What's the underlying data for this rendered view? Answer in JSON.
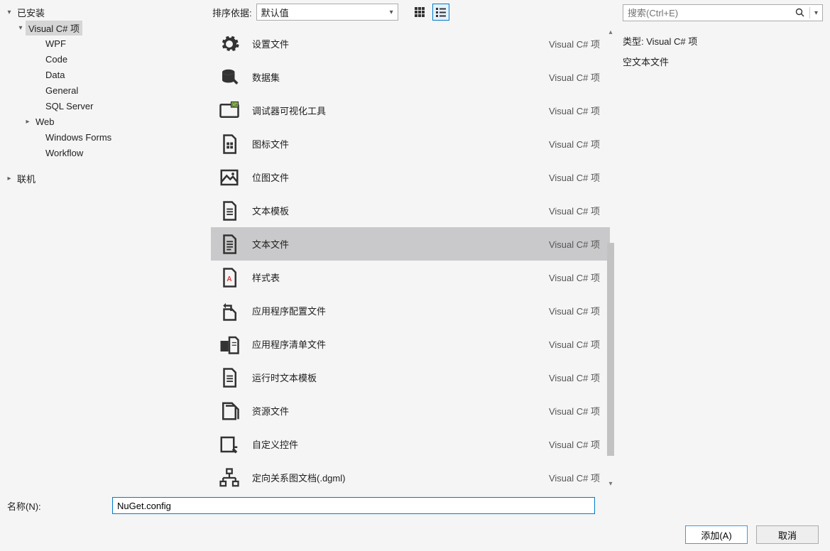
{
  "tree": {
    "installed": "已安装",
    "visual_csharp": "Visual C# 项",
    "children": [
      "WPF",
      "Code",
      "Data",
      "General",
      "SQL Server",
      "Web",
      "Windows Forms",
      "Workflow"
    ],
    "online": "联机"
  },
  "toolbar": {
    "sort_label": "排序依据:",
    "sort_value": "默认值"
  },
  "templates": [
    {
      "name": "设置文件",
      "cat": "Visual C# 项"
    },
    {
      "name": "数据集",
      "cat": "Visual C# 项"
    },
    {
      "name": "调试器可视化工具",
      "cat": "Visual C# 项"
    },
    {
      "name": "图标文件",
      "cat": "Visual C# 项"
    },
    {
      "name": "位图文件",
      "cat": "Visual C# 项"
    },
    {
      "name": "文本模板",
      "cat": "Visual C# 项"
    },
    {
      "name": "文本文件",
      "cat": "Visual C# 项",
      "selected": true
    },
    {
      "name": "样式表",
      "cat": "Visual C# 项"
    },
    {
      "name": "应用程序配置文件",
      "cat": "Visual C# 项"
    },
    {
      "name": "应用程序清单文件",
      "cat": "Visual C# 项"
    },
    {
      "name": "运行时文本模板",
      "cat": "Visual C# 项"
    },
    {
      "name": "资源文件",
      "cat": "Visual C# 项"
    },
    {
      "name": "自定义控件",
      "cat": "Visual C# 项"
    },
    {
      "name": "定向关系图文档(.dgml)",
      "cat": "Visual C# 项"
    }
  ],
  "search": {
    "placeholder": "搜索(Ctrl+E)"
  },
  "info": {
    "type_label": "类型:",
    "type_value": "Visual C# 项",
    "desc": "空文本文件"
  },
  "bottom": {
    "name_label": "名称(N):",
    "name_value": "NuGet.config",
    "add": "添加(A)",
    "cancel": "取消"
  }
}
